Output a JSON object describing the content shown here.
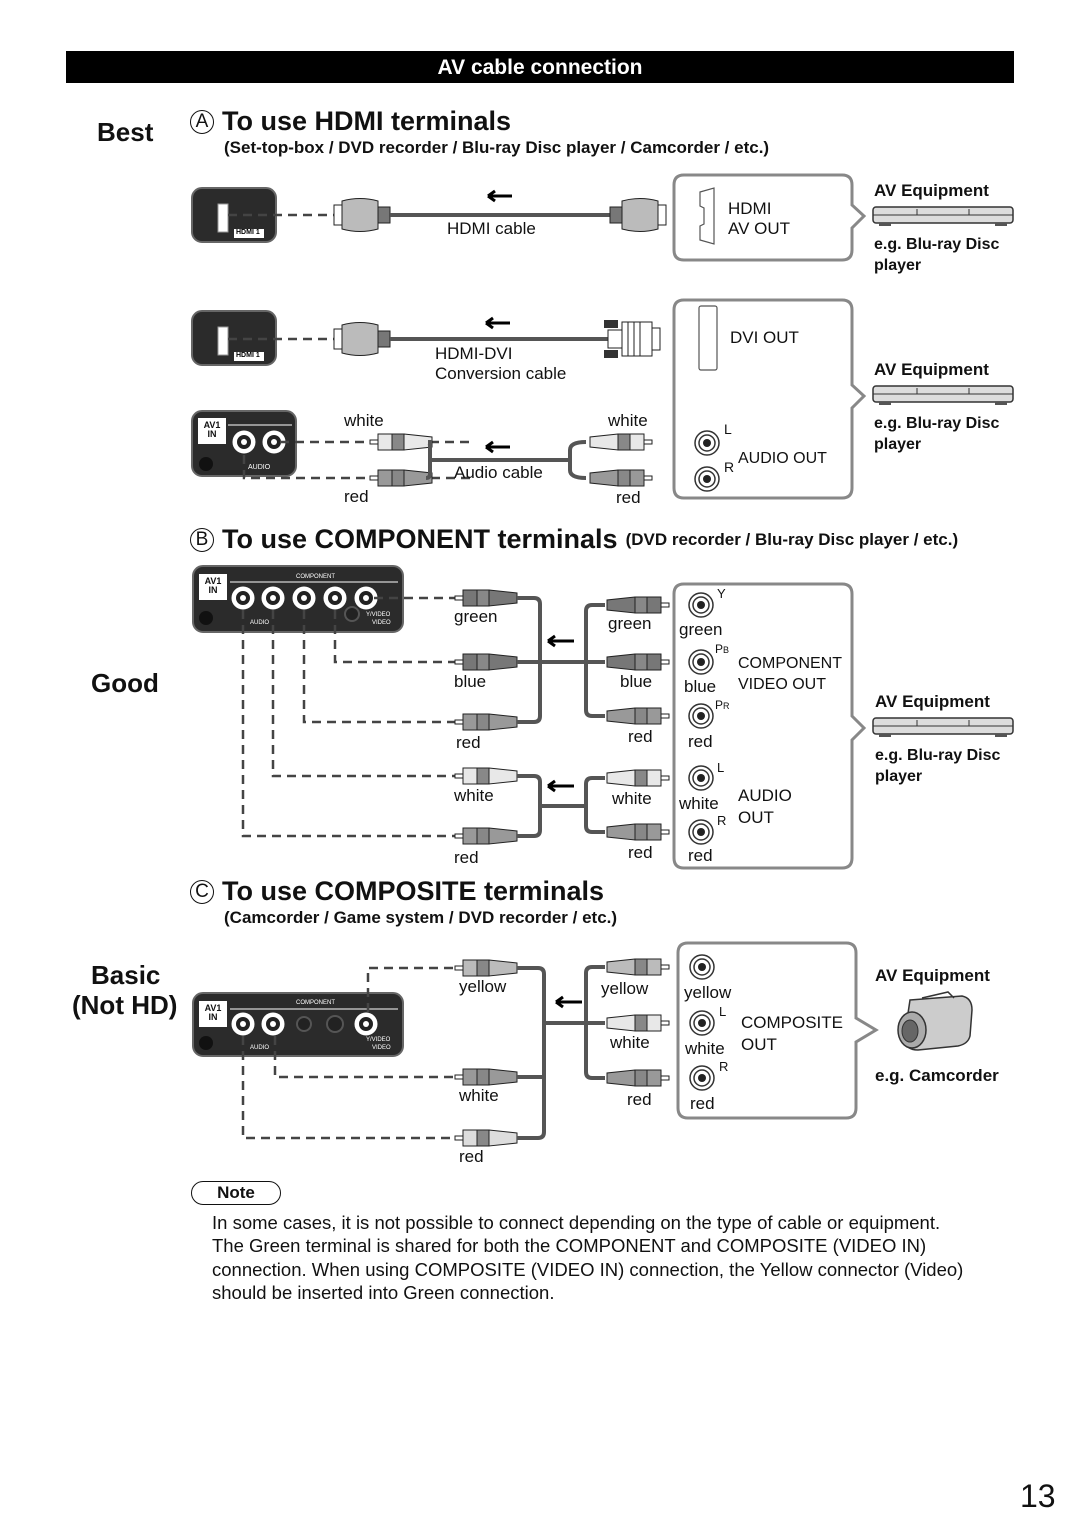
{
  "header": {
    "title": "AV cable connection"
  },
  "ranks": {
    "best": "Best",
    "good": "Good",
    "basic_line1": "Basic",
    "basic_line2": "(Not HD)"
  },
  "section_a": {
    "marker": "A",
    "title": "To use HDMI terminals",
    "subtitle": "(Set-top-box / DVD recorder / Blu-ray Disc player / Camcorder / etc.)",
    "tv_port_label": "HDMI 1",
    "hdmi_cable_label": "HDMI cable",
    "hdmi_out_line1": "HDMI",
    "hdmi_out_line2": "AV OUT",
    "dvi_cable_line1": "HDMI-DVI",
    "dvi_cable_line2": "Conversion cable",
    "dvi_out": "DVI OUT",
    "audio_cable_label": "Audio cable",
    "audio_out": "AUDIO OUT",
    "tv_av_in_line1": "AV1",
    "tv_av_in_line2": "IN",
    "tv_audio": "AUDIO",
    "plug_colors": {
      "white": "white",
      "red": "red"
    },
    "jack_L": "L",
    "jack_R": "R",
    "equipment_1": {
      "label": "AV Equipment",
      "example_line1": "e.g. Blu-ray Disc",
      "example_line2": "player"
    },
    "equipment_2": {
      "label": "AV Equipment",
      "example_line1": "e.g. Blu-ray Disc",
      "example_line2": "player"
    }
  },
  "section_b": {
    "marker": "B",
    "title": "To use COMPONENT terminals",
    "subtitle": "(DVD recorder / Blu-ray Disc player / etc.)",
    "tv_av_in_line1": "AV1",
    "tv_av_in_line2": "IN",
    "tv_component": "COMPONENT",
    "tv_audio": "AUDIO",
    "tv_yvideo": "Y/VIDEO",
    "tv_video": "VIDEO",
    "left_plugs": [
      "green",
      "blue",
      "red",
      "white",
      "red"
    ],
    "right_plugs": [
      "green",
      "blue",
      "red",
      "white",
      "red"
    ],
    "jack_colors": [
      "green",
      "blue",
      "red",
      "white",
      "red"
    ],
    "jack_marks": [
      "Y",
      "PB",
      "PR",
      "L",
      "R"
    ],
    "component_out_line1": "COMPONENT",
    "component_out_line2": "VIDEO OUT",
    "audio_out_line1": "AUDIO",
    "audio_out_line2": "OUT",
    "equipment": {
      "label": "AV Equipment",
      "example_line1": "e.g. Blu-ray Disc",
      "example_line2": "player"
    }
  },
  "section_c": {
    "marker": "C",
    "title": "To use COMPOSITE terminals",
    "subtitle": "(Camcorder / Game system / DVD recorder / etc.)",
    "left_plugs": [
      "yellow",
      "white",
      "red"
    ],
    "right_plugs": [
      "yellow",
      "white",
      "red"
    ],
    "jack_colors": [
      "yellow",
      "white",
      "red"
    ],
    "jack_marks": [
      "",
      "L",
      "R"
    ],
    "composite_out_line1": "COMPOSITE",
    "composite_out_line2": "OUT",
    "equipment": {
      "label": "AV Equipment",
      "example": "e.g. Camcorder"
    }
  },
  "note": {
    "badge": "Note",
    "paragraphs": [
      "In some cases, it is not possible to connect depending on the type of cable or equipment.",
      "The Green terminal is shared for both the COMPONENT and COMPOSITE (VIDEO IN) connection. When using COMPOSITE (VIDEO IN) connection, the Yellow connector (Video) should be inserted into Green connection."
    ]
  },
  "page_number": "13"
}
